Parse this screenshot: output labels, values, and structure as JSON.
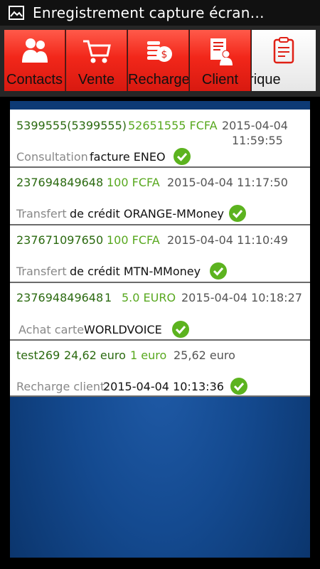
{
  "status_bar": {
    "title": "Enregistrement capture écran…",
    "icon": "screenshot-icon"
  },
  "tabs": [
    {
      "label": "Contacts",
      "icon": "contacts-icon"
    },
    {
      "label": "Vente",
      "icon": "cart-icon"
    },
    {
      "label": "Recharge",
      "icon": "coins-icon"
    },
    {
      "label": "Client",
      "icon": "client-icon"
    },
    {
      "label": "orique",
      "icon": "history-icon",
      "active": true
    }
  ],
  "transactions": [
    {
      "number": "5399555(5399555)",
      "amount": "52651555 FCFA",
      "date": "2015-04-04",
      "time": "11:59:55",
      "type": "Consultation",
      "detail": "facture ENEO",
      "status": "success"
    },
    {
      "number": "237694849648",
      "amount": "100 FCFA",
      "datetime": "2015-04-04 11:17:50",
      "type": "Transfert",
      "detail": "de crédit ORANGE-MMoney",
      "status": "success"
    },
    {
      "number": "237671097650",
      "amount": "100 FCFA",
      "datetime": "2015-04-04 11:10:49",
      "type": "Transfert",
      "detail": "de crédit MTN-MMoney",
      "status": "success"
    },
    {
      "number": "237694849648",
      "qty": "1",
      "amount": "5.0 EURO",
      "datetime": "2015-04-04 10:18:27",
      "type": "Achat carte",
      "detail": "WORLDVOICE",
      "status": "success"
    },
    {
      "number": "test269",
      "balance_before": "24,62 euro",
      "amount": "1 euro",
      "balance_after": "25,62 euro",
      "type": "Recharge client",
      "detail": "2015-04-04 10:13:36",
      "status": "success"
    }
  ],
  "colors": {
    "tab_red": "#f2271a",
    "amount_green": "#58a81f",
    "number_green": "#2b6a10",
    "check_green": "#5cb31f",
    "background_blue": "#144a90"
  }
}
